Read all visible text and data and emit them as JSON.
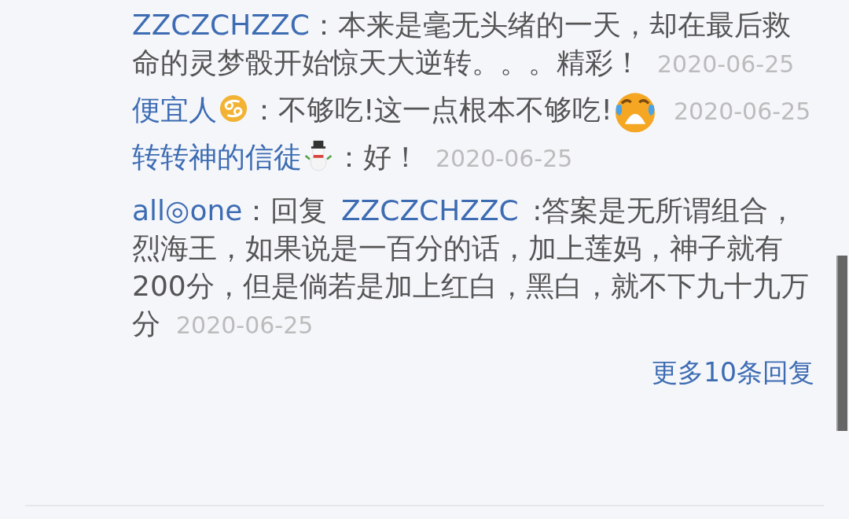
{
  "replies": [
    {
      "author": "ZZCZCHZZC",
      "text": "：本来是毫无头绪的一天，却在最后救命的灵梦骰开始惊天大逆转。。。精彩！",
      "date": "2020-06-25"
    },
    {
      "author": "便宜人",
      "badge": {
        "kind": "zodiac"
      },
      "text": "：不够吃!这一点根本不够吃!",
      "emoji": {
        "kind": "crying"
      },
      "date": "2020-06-25"
    },
    {
      "author": "转转神的信徒",
      "badge": {
        "kind": "snowman"
      },
      "text": "：好！",
      "date": "2020-06-25"
    },
    {
      "author": "all◎one",
      "text": "：回复 ",
      "mention": "ZZCZCHZZC",
      "rest": " :答案是无所谓组合，烈海王，如果说是一百分的话，加上莲妈，神子就有200分，但是倘若是加上红白，黑白，就不下九十九万分",
      "date": "2020-06-25"
    }
  ],
  "more_replies": "更多10条回复"
}
